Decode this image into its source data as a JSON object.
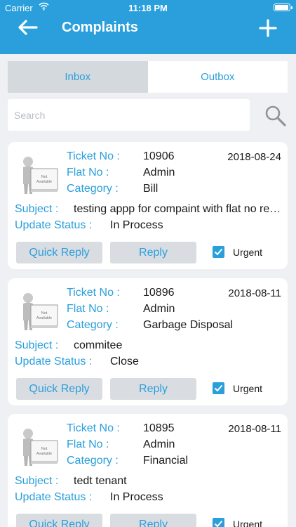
{
  "status_bar": {
    "carrier": "Carrier",
    "time": "11:18 PM"
  },
  "header": {
    "title": "Complaints"
  },
  "tabs": [
    {
      "label": "Inbox",
      "active": true
    },
    {
      "label": "Outbox",
      "active": false
    }
  ],
  "search": {
    "placeholder": "Search",
    "value": ""
  },
  "labels": {
    "ticket_no": "Ticket No :",
    "flat_no": "Flat No :",
    "category": "Category :",
    "subject": "Subject :",
    "update_status": "Update Status :",
    "quick_reply": "Quick Reply",
    "reply": "Reply",
    "urgent": "Urgent",
    "avatar_line1": "Not",
    "avatar_line2": "Available"
  },
  "complaints": [
    {
      "ticket_no": "10906",
      "date": "2018-08-24",
      "flat_no": "Admin",
      "category": "Bill",
      "subject": "testing appp for compaint with flat no remarks",
      "status": "In Process",
      "urgent": true
    },
    {
      "ticket_no": "10896",
      "date": "2018-08-11",
      "flat_no": "Admin",
      "category": "Garbage Disposal",
      "subject": "commitee",
      "status": "Close",
      "urgent": true
    },
    {
      "ticket_no": "10895",
      "date": "2018-08-11",
      "flat_no": "Admin",
      "category": "Financial",
      "subject": "tedt tenant",
      "status": "In Process",
      "urgent": true
    }
  ],
  "colors": {
    "accent": "#2a9fdc",
    "header_bg": "#2a9fdc",
    "background": "#eef0f3",
    "button_bg": "#d9dde2",
    "text": "#1a1a1a"
  },
  "icons": {
    "back": "arrow-left-icon",
    "add": "plus-icon",
    "search": "magnifier-icon",
    "wifi": "wifi-icon",
    "battery": "battery-icon",
    "checkbox": "checkmark-icon"
  }
}
